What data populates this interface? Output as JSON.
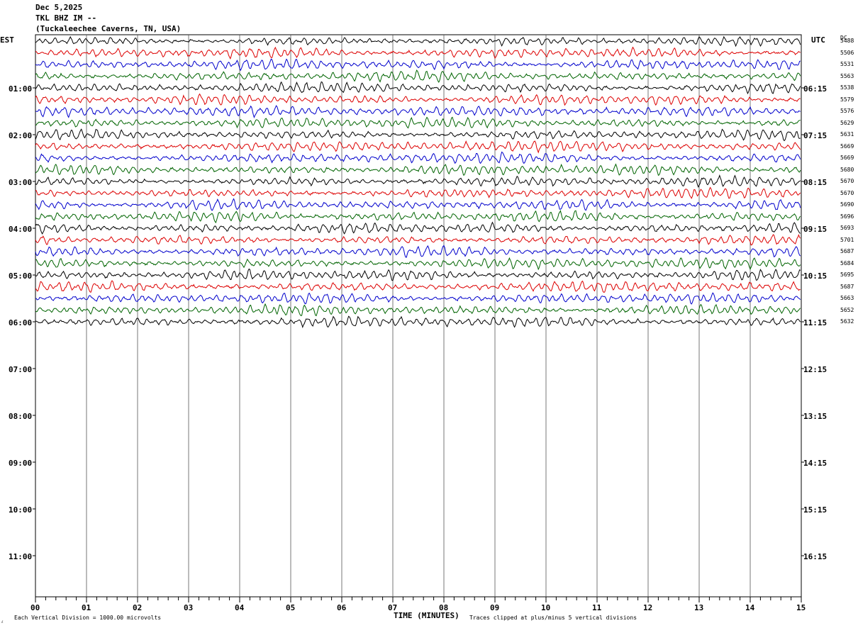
{
  "header": {
    "date": "Dec 5,2025",
    "station": "TKL BHZ IM --",
    "location": "(Tuckaleechee Caverns, TN, USA)"
  },
  "axes": {
    "left_tz": "EST",
    "right_tz": "UTC",
    "dc_header": "DC",
    "x_title": "TIME (MINUTES)",
    "footer_left": "Each Vertical Division = 1000.00 microvolts",
    "footer_right": "Traces clipped at plus/minus 5 vertical divisions",
    "corner_mark": "⁁"
  },
  "chart_data": {
    "type": "line",
    "title": "",
    "xlabel": "TIME (MINUTES)",
    "xlim": [
      0,
      15
    ],
    "x_ticks": [
      "00",
      "01",
      "02",
      "03",
      "04",
      "05",
      "06",
      "07",
      "08",
      "09",
      "10",
      "11",
      "12",
      "13",
      "14",
      "15"
    ],
    "left_hour_labels": [
      "01:00",
      "02:00",
      "03:00",
      "04:00",
      "05:00",
      "06:00",
      "07:00",
      "08:00",
      "09:00",
      "10:00",
      "11:00"
    ],
    "right_hour_labels": [
      "06:15",
      "07:15",
      "08:15",
      "09:15",
      "10:15",
      "11:15",
      "12:15",
      "13:15",
      "14:15",
      "15:15",
      "16:15"
    ],
    "traces_per_hour": 4,
    "trace_colors": [
      "#000000",
      "#dd0000",
      "#0000cc",
      "#006400"
    ],
    "trace_count": 25,
    "dc_offsets": [
      5488,
      5506,
      5531,
      5563,
      5538,
      5579,
      5576,
      5629,
      5631,
      5669,
      5669,
      5680,
      5670,
      5670,
      5690,
      5696,
      5693,
      5701,
      5687,
      5684,
      5695,
      5687,
      5663,
      5652,
      5632
    ],
    "clip_divisions": 5,
    "microvolts_per_division": 1000
  }
}
